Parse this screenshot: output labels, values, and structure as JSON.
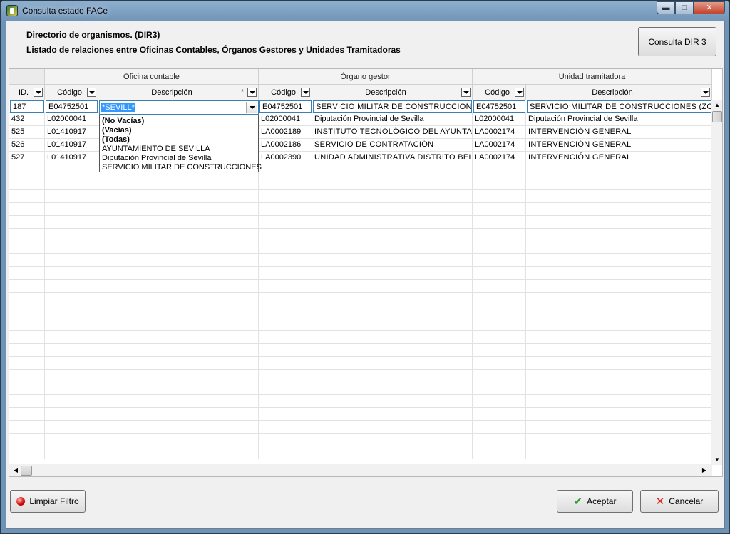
{
  "window": {
    "title": "Consulta estado FACe",
    "controls": {
      "minimize": "▬",
      "maximize": "□",
      "close": "✕"
    }
  },
  "header": {
    "title": "Directorio de organismos. (DIR3)",
    "subtitle": "Listado de relaciones entre Oficinas Contables, Órganos Gestores y Unidades Tramitadoras",
    "dir3_button": "Consulta DIR 3"
  },
  "grid": {
    "bands": [
      "Oficina contable",
      "Órgano gestor",
      "Unidad tramitadora"
    ],
    "columns": [
      "ID.",
      "Código",
      "Descripción",
      "Código",
      "Descripción",
      "Código",
      "Descripción"
    ],
    "filter_marker": "*",
    "filter_row": {
      "id": "187",
      "oc_codigo": "E04752501",
      "oc_descripcion": "*SEVILL*",
      "og_codigo": "E04752501",
      "og_descripcion": "SERVICIO MILITAR DE CONSTRUCCIONES",
      "ut_codigo": "E04752501",
      "ut_descripcion": "SERVICIO MILITAR DE CONSTRUCCIONES (ZONA ..."
    },
    "rows": [
      [
        "432",
        "L02000041",
        "",
        "L02000041",
        "Diputación Provincial de Sevilla",
        "L02000041",
        "Diputación Provincial de Sevilla"
      ],
      [
        "525",
        "L01410917",
        "",
        "LA0002189",
        "INSTITUTO TECNOLÓGICO DEL AYUNTAMIENTO",
        "LA0002174",
        "INTERVENCIÓN GENERAL"
      ],
      [
        "526",
        "L01410917",
        "",
        "LA0002186",
        "SERVICIO DE CONTRATACIÓN",
        "LA0002174",
        "INTERVENCIÓN GENERAL"
      ],
      [
        "527",
        "L01410917",
        "",
        "LA0002390",
        "UNIDAD ADMINISTRATIVA DISTRITO BELLAVISTA",
        "LA0002174",
        "INTERVENCIÓN GENERAL"
      ]
    ],
    "dropdown_options": [
      "(No Vacías)",
      "(Vacías)",
      "(Todas)",
      "AYUNTAMIENTO DE SEVILLA",
      "Diputación Provincial de Sevilla",
      "SERVICIO MILITAR DE CONSTRUCCIONES"
    ]
  },
  "footer": {
    "clear_filter": "Limpiar Filtro",
    "accept": "Aceptar",
    "cancel": "Cancelar"
  },
  "icons": {
    "app": "app-icon",
    "clear": "red-dot-icon",
    "accept": "check-icon",
    "cancel": "cross-icon"
  },
  "colors": {
    "selection": "#3399ff",
    "accent_border": "#3c7fb1"
  }
}
